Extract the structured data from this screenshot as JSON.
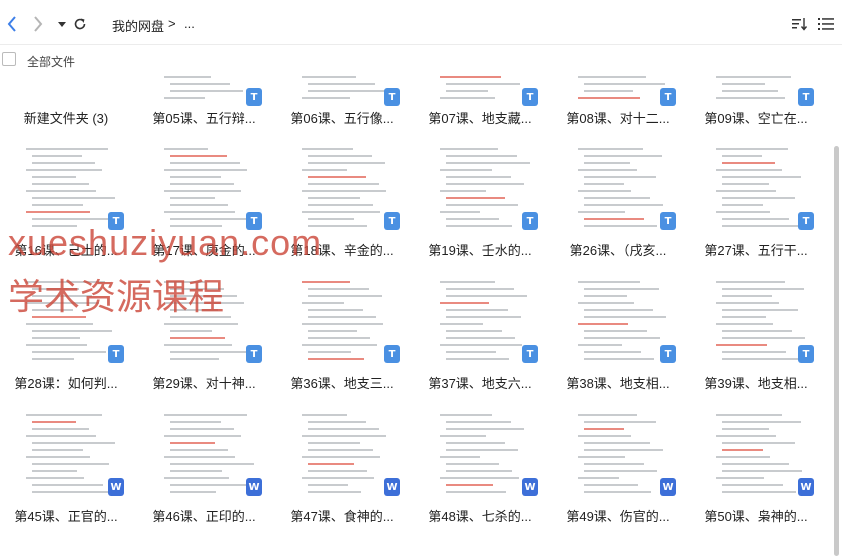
{
  "toolbar": {
    "back_icon": "chevron-left",
    "forward_icon": "chevron-right",
    "dropdown_icon": "caret-down",
    "refresh_icon": "refresh",
    "breadcrumb_root": "我的网盘",
    "breadcrumb_sep": ">",
    "breadcrumb_more": "...",
    "sort_icon": "sort",
    "list_view_icon": "list",
    "accent_color": "#3d7fe8"
  },
  "selection": {
    "all_files_label": "全部文件"
  },
  "files": [
    {
      "name": "新建文件夹 (3)",
      "type": "folder"
    },
    {
      "name": "第05课、五行辩...",
      "type": "text"
    },
    {
      "name": "第06课、五行像...",
      "type": "text"
    },
    {
      "name": "第07课、地支藏...",
      "type": "text"
    },
    {
      "name": "第08课、对十二...",
      "type": "text"
    },
    {
      "name": "第09课、空亡在...",
      "type": "text"
    },
    {
      "name": "第16课、己土的...",
      "type": "text"
    },
    {
      "name": "第17课、庚金的...",
      "type": "text"
    },
    {
      "name": "第18课、辛金的...",
      "type": "text"
    },
    {
      "name": "第19课、壬水的...",
      "type": "text"
    },
    {
      "name": "第26课、（戌亥...",
      "type": "text"
    },
    {
      "name": "第27课、五行干...",
      "type": "text"
    },
    {
      "name": "第28课：如何判...",
      "type": "text"
    },
    {
      "name": "第29课、对十神...",
      "type": "text"
    },
    {
      "name": "第36课、地支三...",
      "type": "text"
    },
    {
      "name": "第37课、地支六...",
      "type": "text"
    },
    {
      "name": "第38课、地支相...",
      "type": "text"
    },
    {
      "name": "第39课、地支相...",
      "type": "text"
    },
    {
      "name": "第45课、正官的...",
      "type": "word"
    },
    {
      "name": "第46课、正印的...",
      "type": "word"
    },
    {
      "name": "第47课、食神的...",
      "type": "word"
    },
    {
      "name": "第48课、七杀的...",
      "type": "word"
    },
    {
      "name": "第49课、伤官的...",
      "type": "word"
    },
    {
      "name": "第50课、枭神的...",
      "type": "word"
    }
  ],
  "badges": {
    "text": "T",
    "word": "W"
  },
  "watermark": {
    "line1": "xueshuziyuan.com",
    "line2": "学术资源课程"
  }
}
